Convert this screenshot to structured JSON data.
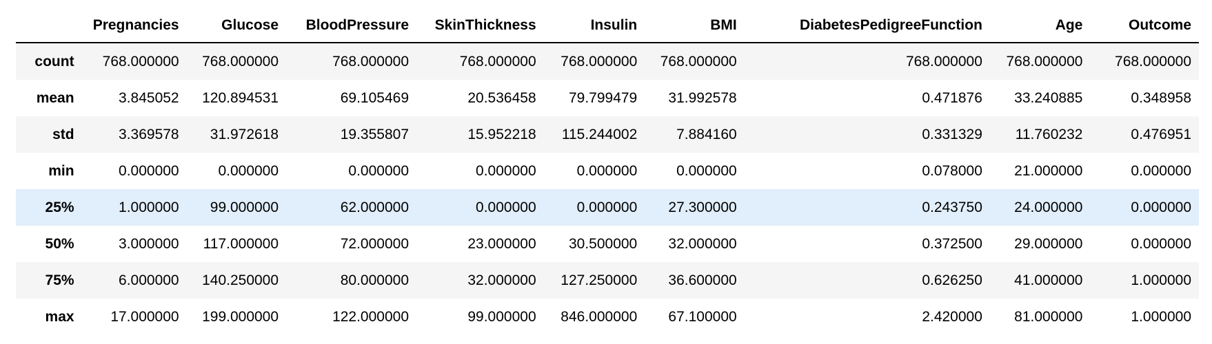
{
  "table": {
    "index_header": "",
    "columns": [
      "Pregnancies",
      "Glucose",
      "BloodPressure",
      "SkinThickness",
      "Insulin",
      "BMI",
      "DiabetesPedigreeFunction",
      "Age",
      "Outcome"
    ],
    "rows": [
      {
        "label": "count",
        "values": [
          "768.000000",
          "768.000000",
          "768.000000",
          "768.000000",
          "768.000000",
          "768.000000",
          "768.000000",
          "768.000000",
          "768.000000"
        ]
      },
      {
        "label": "mean",
        "values": [
          "3.845052",
          "120.894531",
          "69.105469",
          "20.536458",
          "79.799479",
          "31.992578",
          "0.471876",
          "33.240885",
          "0.348958"
        ]
      },
      {
        "label": "std",
        "values": [
          "3.369578",
          "31.972618",
          "19.355807",
          "15.952218",
          "115.244002",
          "7.884160",
          "0.331329",
          "11.760232",
          "0.476951"
        ]
      },
      {
        "label": "min",
        "values": [
          "0.000000",
          "0.000000",
          "0.000000",
          "0.000000",
          "0.000000",
          "0.000000",
          "0.078000",
          "21.000000",
          "0.000000"
        ]
      },
      {
        "label": "25%",
        "values": [
          "1.000000",
          "99.000000",
          "62.000000",
          "0.000000",
          "0.000000",
          "27.300000",
          "0.243750",
          "24.000000",
          "0.000000"
        ]
      },
      {
        "label": "50%",
        "values": [
          "3.000000",
          "117.000000",
          "72.000000",
          "23.000000",
          "30.500000",
          "32.000000",
          "0.372500",
          "29.000000",
          "0.000000"
        ]
      },
      {
        "label": "75%",
        "values": [
          "6.000000",
          "140.250000",
          "80.000000",
          "32.000000",
          "127.250000",
          "36.600000",
          "0.626250",
          "41.000000",
          "1.000000"
        ]
      },
      {
        "label": "max",
        "values": [
          "17.000000",
          "199.000000",
          "122.000000",
          "99.000000",
          "846.000000",
          "67.100000",
          "2.420000",
          "81.000000",
          "1.000000"
        ]
      }
    ],
    "highlighted_row": 4
  },
  "colors": {
    "stripe": "#f5f5f5",
    "highlight": "#e1eefb",
    "rule": "#000000"
  }
}
